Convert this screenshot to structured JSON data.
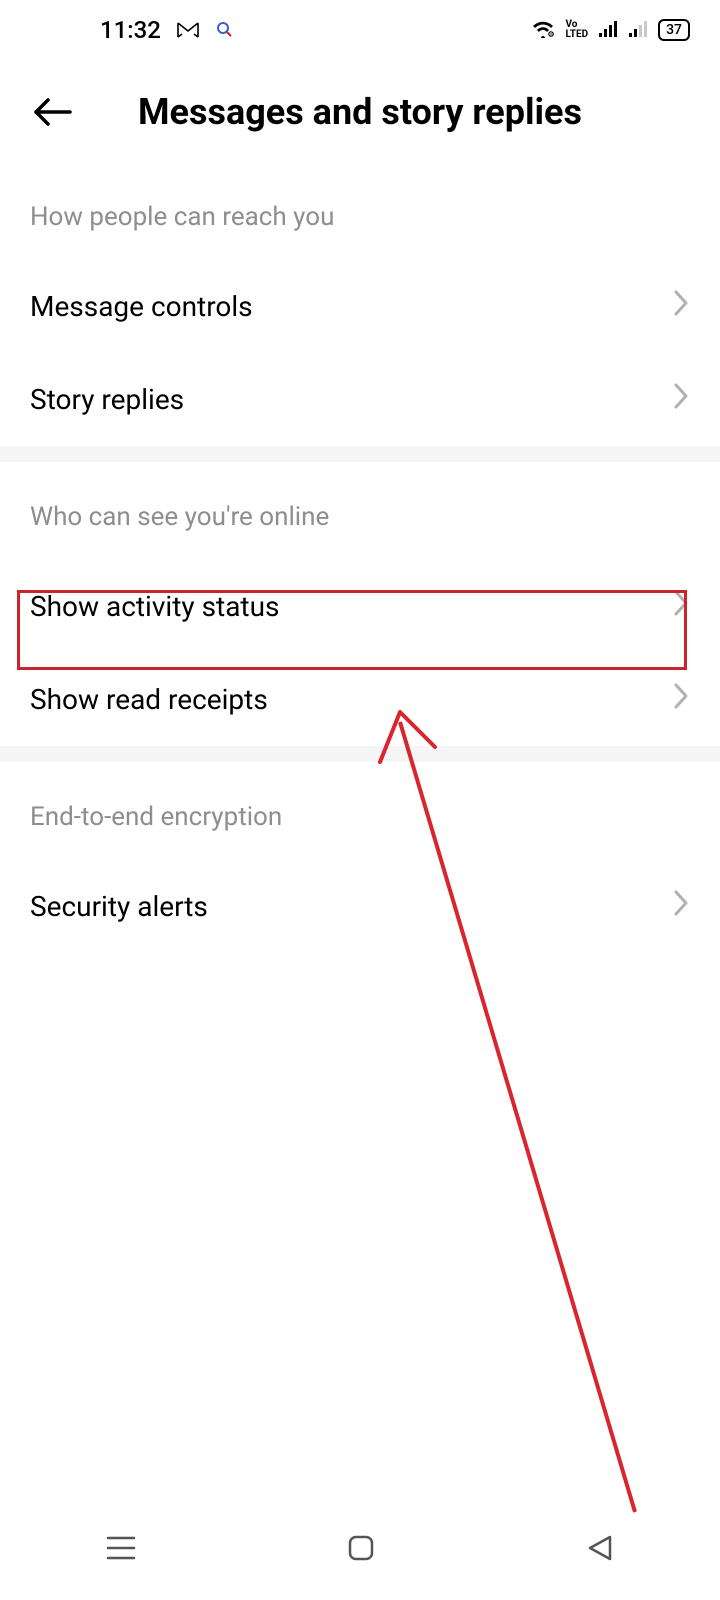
{
  "status_bar": {
    "time": "11:32",
    "volte_label": "Vo\nLTE",
    "battery": "37"
  },
  "header": {
    "title": "Messages and story replies"
  },
  "sections": {
    "section1_header": "How people can reach you",
    "item_message_controls": "Message controls",
    "item_story_replies": "Story replies",
    "section2_header": "Who can see you're online",
    "item_activity_status": "Show activity status",
    "item_read_receipts": "Show read receipts",
    "section3_header": "End-to-end encryption",
    "item_security_alerts": "Security alerts"
  }
}
